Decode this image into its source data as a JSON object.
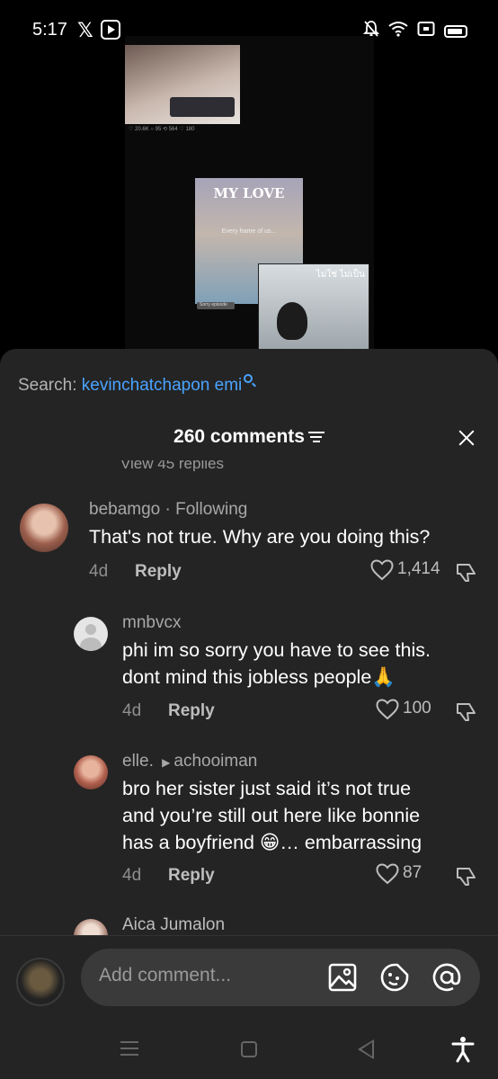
{
  "status_bar": {
    "time": "5:17",
    "notification_icons": [
      "x-logo-icon",
      "app-badge-icon"
    ],
    "right_icons": [
      "bell-off-icon",
      "wifi-icon",
      "cast-icon",
      "battery-icon"
    ]
  },
  "video": {
    "overlay_title": "MY LOVE",
    "overlay_subtitle": "Every frame of us...",
    "tag_label": "Sorry episode",
    "inset_overlay": "ไม่ใช่ ไม่เป็น"
  },
  "sheet": {
    "search_prefix": "Search: ",
    "search_term": "kevinchatchapon emi",
    "header_title": "260 comments",
    "partial_replies": "View 45 replies"
  },
  "comments": [
    {
      "username": "bebamgo",
      "badge": " · Following",
      "text": "That's not true. Why are you doing this?",
      "age": "4d",
      "reply_label": "Reply",
      "likes": "1,414",
      "avatar_color": "#c98b7a"
    },
    {
      "username": "mnbvcx",
      "text_line1": "phi im so sorry you have to see this.",
      "text_line2": "dont mind this jobless people🙏",
      "age": "4d",
      "reply_label": "Reply",
      "likes": "100",
      "avatar_color": "#e5e5e5"
    },
    {
      "username": "elle.",
      "reply_to": "achooiman",
      "text_line1": "bro her sister just said it’s not true",
      "text_line2": "and you’re still out here like bonnie",
      "text_line3": "has a boyfriend 😁… embarrassing",
      "age": "4d",
      "reply_label": "Reply",
      "likes": "87",
      "avatar_color": "#b0604e"
    },
    {
      "username": "Aica Jumalon",
      "avatar_color": "#d6c2b8"
    }
  ],
  "composer": {
    "placeholder": "Add comment..."
  },
  "nav": {
    "accessibility_glyph": "🕴"
  },
  "colors": {
    "sheet_bg": "#242424",
    "link_blue": "#4aa3ff",
    "input_bg": "#3a3a3a"
  }
}
